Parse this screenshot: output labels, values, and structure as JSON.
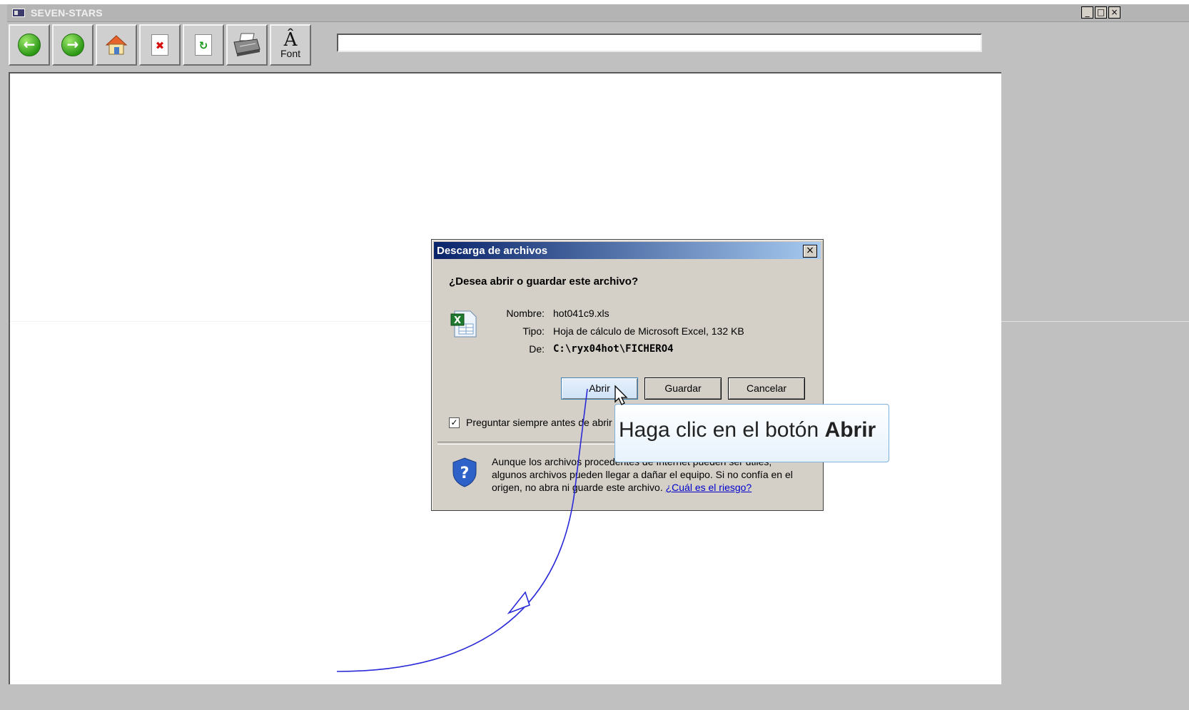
{
  "window": {
    "title": "SEVEN-STARS",
    "minimize": "_",
    "maximize": "□",
    "close": "×"
  },
  "toolbar": {
    "buttons": [
      {
        "name": "back",
        "icon": "back-arrow-icon"
      },
      {
        "name": "forward",
        "icon": "forward-arrow-icon"
      },
      {
        "name": "home",
        "icon": "home-icon"
      },
      {
        "name": "stop",
        "icon": "stop-icon"
      },
      {
        "name": "refresh",
        "icon": "refresh-icon"
      },
      {
        "name": "print",
        "icon": "printer-icon"
      },
      {
        "name": "font",
        "icon": "font-icon"
      }
    ],
    "font_label": "Font",
    "address_value": ""
  },
  "dialog": {
    "title": "Descarga de archivos",
    "close_glyph": "×",
    "question": "¿Desea abrir o guardar este archivo?",
    "fields": [
      {
        "label": "Nombre:",
        "value": "hot041c9.xls"
      },
      {
        "label": "Tipo:",
        "value": "Hoja de cálculo de Microsoft Excel, 132 KB"
      },
      {
        "label": "De:",
        "value": "C:\\ryx04hot\\FICHERO4"
      }
    ],
    "buttons": {
      "open": "Abrir",
      "save": "Guardar",
      "cancel": "Cancelar"
    },
    "checkbox": {
      "label": "Preguntar siempre antes de abrir este tipo de archivos",
      "checked": true,
      "mark": "✓"
    },
    "warning": {
      "text": "Aunque los archivos procedentes de Internet pueden ser útiles, algunos archivos pueden llegar a dañar el equipo. Si no confía en el origen, no abra ni guarde este archivo.",
      "link": "¿Cuál es el riesgo?"
    }
  },
  "callout": {
    "text": "Haga clic en el botón",
    "emphasis": "Abrir"
  },
  "colors": {
    "path_line": "#2a2ad8",
    "titlebar": "#0a246a"
  }
}
